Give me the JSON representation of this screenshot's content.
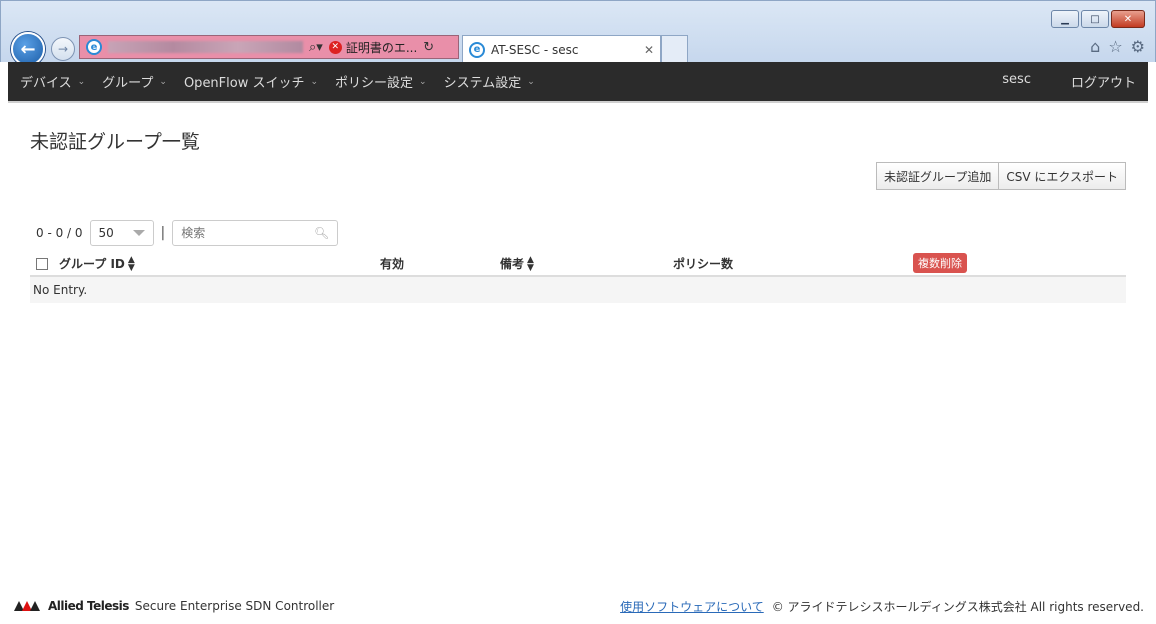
{
  "browser": {
    "address_error": "証明書のエ...",
    "tab_title": "AT-SESC - sesc"
  },
  "navbar": {
    "menu": [
      "デバイス",
      "グループ",
      "OpenFlow スイッチ",
      "ポリシー設定",
      "システム設定"
    ],
    "user": "sesc",
    "logout": "ログアウト"
  },
  "page": {
    "title": "未認証グループ一覧",
    "add_button": "未認証グループ追加",
    "export_button": "CSV にエクスポート",
    "count": "0 - 0 / 0",
    "page_size": "50",
    "search_placeholder": "検索",
    "columns": {
      "group_id": "グループ ID",
      "enabled": "有効",
      "note": "備考",
      "policy_count": "ポリシー数",
      "bulk_delete": "複数削除"
    },
    "empty": "No Entry."
  },
  "footer": {
    "brand": "Allied Telesis",
    "product": "Secure Enterprise SDN Controller",
    "link": "使用ソフトウェアについて",
    "copyright": "© アライドテレシスホールディングス株式会社 All rights reserved."
  }
}
